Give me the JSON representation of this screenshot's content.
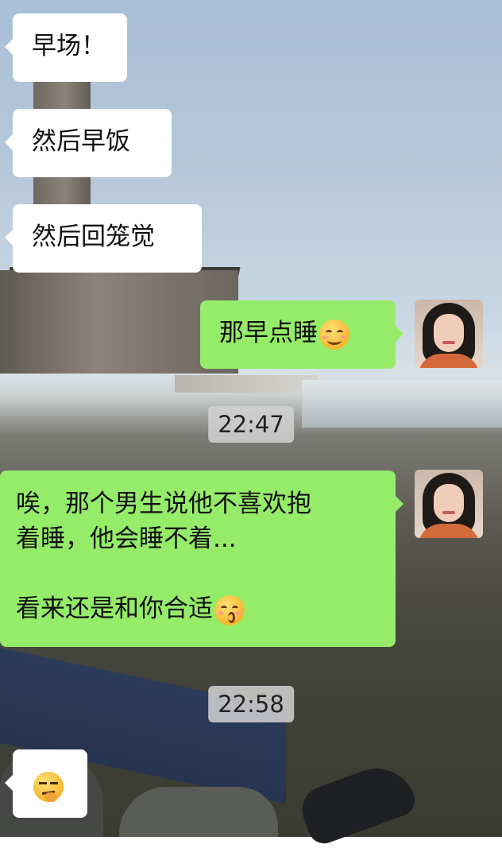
{
  "messages": [
    {
      "from": "other",
      "text": "早场！"
    },
    {
      "from": "other",
      "text": "然后早饭"
    },
    {
      "from": "other",
      "text": "然后回笼觉"
    },
    {
      "from": "me",
      "text": "那早点睡",
      "emoji": "smiling-face-icon"
    },
    {
      "type": "timestamp",
      "text": "22:47"
    },
    {
      "from": "me",
      "lines": [
        "唉，那个男生说他不喜欢抱",
        "着睡，他会睡不着...",
        "",
        "看来还是和你合适"
      ],
      "emoji": "kissing-face-icon"
    },
    {
      "type": "timestamp",
      "text": "22:58"
    },
    {
      "from": "other",
      "emoji": "thinking-face-icon"
    }
  ],
  "colors": {
    "outgoing_bubble": "#95ec69",
    "incoming_bubble": "#ffffff",
    "timestamp_bg": "#d2d2d2"
  }
}
